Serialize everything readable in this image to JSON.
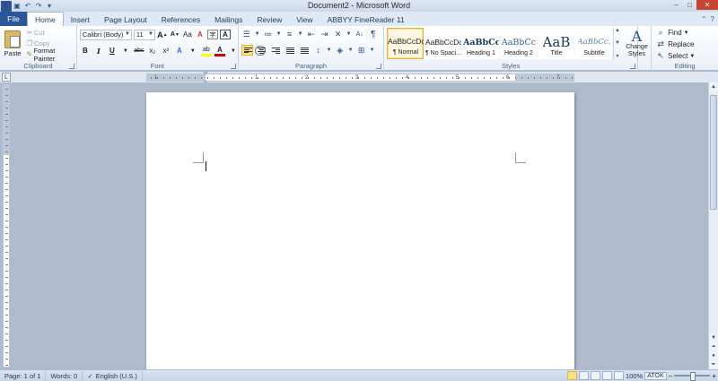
{
  "window": {
    "title": "Document2 - Microsoft Word",
    "logo": "W",
    "controls": {
      "minimize": "–",
      "maximize": "□",
      "close": "✕"
    }
  },
  "qat": {
    "icons": [
      "save-icon",
      "undo-icon",
      "redo-icon",
      "customize-icon"
    ]
  },
  "tabs": [
    {
      "label": "File"
    },
    {
      "label": "Home"
    },
    {
      "label": "Insert"
    },
    {
      "label": "Page Layout"
    },
    {
      "label": "References"
    },
    {
      "label": "Mailings"
    },
    {
      "label": "Review"
    },
    {
      "label": "View"
    },
    {
      "label": "ABBYY FineReader 11"
    }
  ],
  "ribbon": {
    "clipboard": {
      "label": "Clipboard",
      "paste": "Paste",
      "cut": "Cut",
      "copy": "Copy",
      "format_painter": "Format Painter"
    },
    "font": {
      "label": "Font",
      "family": "Calibri (Body)",
      "size": "11",
      "bold": "B",
      "italic": "I",
      "underline": "U",
      "strike": "abc",
      "subscript": "x₂",
      "superscript": "x²",
      "grow": "A",
      "shrink": "A",
      "change_case": "Aa",
      "clear": "A",
      "text_effects": "A",
      "highlight": "ab",
      "font_color": "A",
      "char_shading": "A",
      "enclose": "字"
    },
    "paragraph": {
      "label": "Paragraph",
      "sort": "A↓",
      "show_marks": "¶"
    },
    "styles": {
      "label": "Styles",
      "items": [
        {
          "sample": "AaBbCcDc",
          "name": "¶ Normal"
        },
        {
          "sample": "AaBbCcDc",
          "name": "¶ No Spaci..."
        },
        {
          "sample": "AaBbCc",
          "name": "Heading 1"
        },
        {
          "sample": "AaBbCc",
          "name": "Heading 2"
        },
        {
          "sample": "AaB",
          "name": "Title"
        },
        {
          "sample": "AaBbCc.",
          "name": "Subtitle"
        }
      ],
      "change_styles_line1": "Change",
      "change_styles_line2": "Styles"
    },
    "editing": {
      "label": "Editing",
      "find": "Find",
      "replace": "Replace",
      "select": "Select"
    }
  },
  "ruler": {
    "corner": "L",
    "numbers": [
      "1",
      "1",
      "2",
      "3",
      "4",
      "5",
      "6",
      "7"
    ]
  },
  "status": {
    "page": "Page: 1 of 1",
    "words": "Words: 0",
    "language": "English (U.S.)",
    "zoom": "100%",
    "ime": "ATOK"
  },
  "colors": {
    "file_tab": "#2b579a",
    "highlight": "#ffff00",
    "font_color": "#d00000",
    "selected_style": "#fbe08a"
  }
}
